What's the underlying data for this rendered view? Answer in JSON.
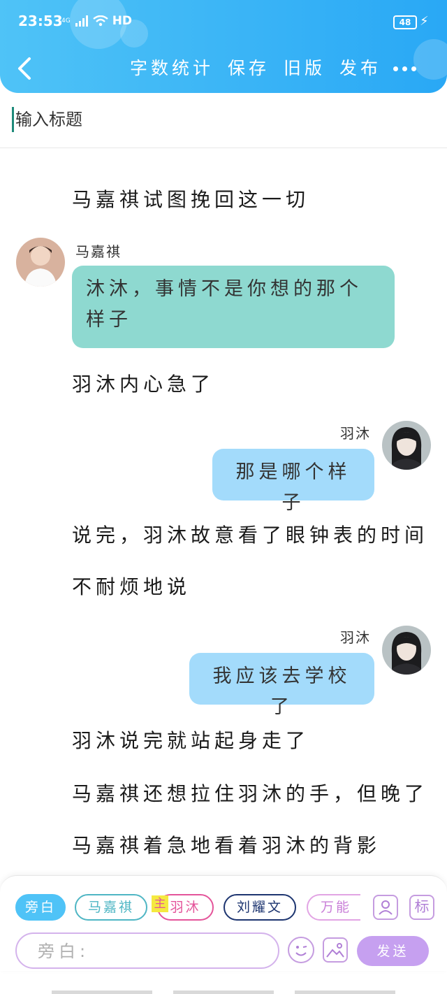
{
  "status_bar": {
    "time": "23:53",
    "network": "4G",
    "hd": "HD",
    "battery": "48"
  },
  "toolbar": {
    "word_count": "字数统计",
    "save": "保存",
    "old_version": "旧版",
    "publish": "发布"
  },
  "title_placeholder": "输入标题",
  "story": {
    "n1": "马嘉祺试图挽回这一切",
    "m1_speaker": "马嘉祺",
    "m1_line1": "沐沐，事情不是你想的那个",
    "m1_line2": "样子",
    "n2": "羽沐内心急了",
    "m2_speaker": "羽沐",
    "m2_text": "那是哪个样子",
    "n3": "说完，羽沐故意看了眼钟表的时间",
    "n4": "不耐烦地说",
    "m3_speaker": "羽沐",
    "m3_text": "我应该去学校了",
    "n5": "羽沐说完就站起身走了",
    "n6": "马嘉祺还想拉住羽沐的手，但晚了",
    "n7": "马嘉祺着急地看着羽沐的背影"
  },
  "roles": {
    "narrator": "旁白",
    "r1": "马嘉祺",
    "r2": "羽沐",
    "r2_tag": "主",
    "r3": "刘耀文",
    "r4": "万能角"
  },
  "mark_label": "标",
  "input_placeholder": "旁白:",
  "send": "发送",
  "colors": {
    "header": "#29a8f5",
    "green_bubble": "#8ed9d0",
    "blue_bubble": "#a3dbfb",
    "send_button": "#c6a0f0"
  }
}
